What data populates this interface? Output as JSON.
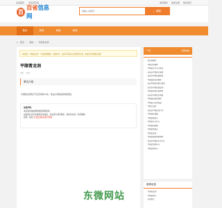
{
  "topbar": {
    "left": [
      "设置首页",
      "手机百草语"
    ],
    "right": [
      "收费服务",
      "免费注册",
      "联系我们"
    ]
  },
  "logo": {
    "badge": "百",
    "brand_a": "百省",
    "brand_b": "信息网"
  },
  "search": {
    "placeholder": "请输入关键词",
    "button": "搜索"
  },
  "nav": {
    "items": [
      "首页",
      "其他",
      "商家",
      "其他"
    ]
  },
  "breadcrumb": [
    "首页",
    "其他",
    "平顺青龙洞"
  ],
  "notice": "本页面：平顺青龙洞 · 介绍来源网络，仅供参考，如有不同请以实际情况为准，本站不承担相应责任",
  "article": {
    "title": "平顺青龙洞",
    "meta": [
      "浏览",
      "时间"
    ],
    "section_title": "单位介绍",
    "description": "平顺青龙洞位于东石鸣西50米，欢迎大家前来参观游览。",
    "warning_title": "免责声明：",
    "warning_lines": [
      "本页面内容由网络收集整理提供，",
      "如发现信息有误或者存在侵权，请立即与我们联系，我们将在第一时间删除",
      "处理，感谢"
    ],
    "warning_highlight": "点击此处联系我们举报"
  },
  "sidebar": {
    "ad_left": "广告",
    "ad_right": "立即投放",
    "hot_title": "热门推荐",
    "hot_items": [
      "青龙洞景区",
      "李家山风景区",
      "平顺县太行山大峡谷",
      "长治市平顺县红旗渠",
      "长治市平顺县通天峡",
      "平顺县神龙湾景区",
      "长治平顺县天脊山景区",
      "长治市平顺县黄崖洞",
      "平顺县天脊山风景区",
      "长治市平顺县红旗渠",
      "平顺县虹梯关景区",
      "平顺县九天圣母庙",
      "平顺大云院",
      "长治市平顺县龙门寺",
      "平顺县赵城镇",
      "平顺县阳高乡",
      "平顺县东寺头乡",
      "平顺县石城镇",
      "平顺县紫团山",
      "平顺青龙洞",
      "平顺县通天峡风景区",
      "长治市平顺县东寺头乡",
      "平顺县北耽车乡",
      "平顺县西沟乡"
    ],
    "rec_title": "推荐信息",
    "rec_items": [
      "平顺青龙洞",
      "平顺县景点",
      "长治景点"
    ]
  },
  "watermark": {
    "a": "东微",
    "b": "网站"
  }
}
